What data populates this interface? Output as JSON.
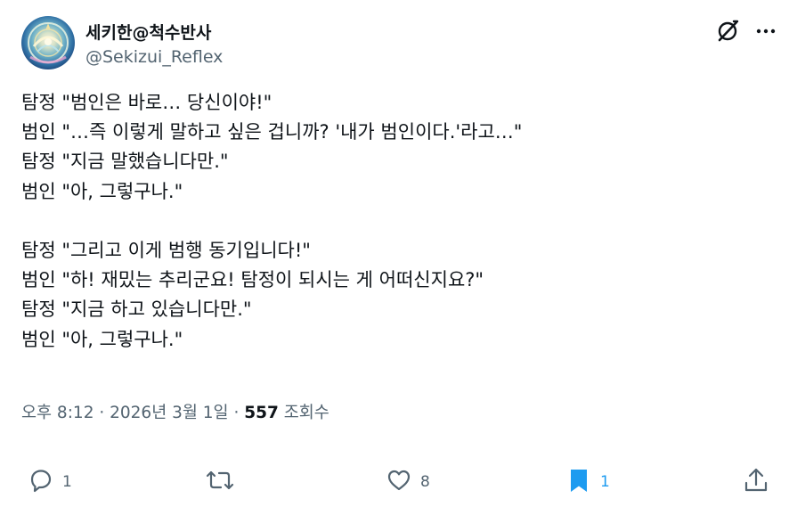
{
  "author": {
    "display_name": "세키한@척수반사",
    "handle": "@Sekizui_Reflex"
  },
  "tweet": {
    "lines": [
      "탐정 \"범인은 바로… 당신이야!\"",
      "범인 \"…즉 이렇게 말하고 싶은 겁니까? '내가 범인이다.'라고…\"",
      "탐정 \"지금 말했습니다만.\"",
      "범인 \"아, 그렇구나.\"",
      "",
      "탐정 \"그리고 이게 범행 동기입니다!\"",
      "범인 \"하! 재밌는 추리군요! 탐정이 되시는 게 어떠신지요?\"",
      "탐정 \"지금 하고 있습니다만.\"",
      "범인 \"아, 그렇구나.\""
    ]
  },
  "meta": {
    "time": "오후 8:12",
    "separator": " · ",
    "date": "2026년 3월 1일",
    "views_count": "557",
    "views_label": " 조회수"
  },
  "actions": {
    "reply_count": "1",
    "retweet_count": "",
    "like_count": "8",
    "bookmark_count": "1"
  },
  "icons": {
    "grok": "grok-icon",
    "more": "more-icon",
    "reply": "reply-icon",
    "retweet": "retweet-icon",
    "like": "heart-icon",
    "bookmark": "bookmark-icon",
    "share": "share-icon"
  },
  "colors": {
    "text": "#0f1419",
    "secondary": "#536471",
    "accent": "#1d9bf0"
  }
}
